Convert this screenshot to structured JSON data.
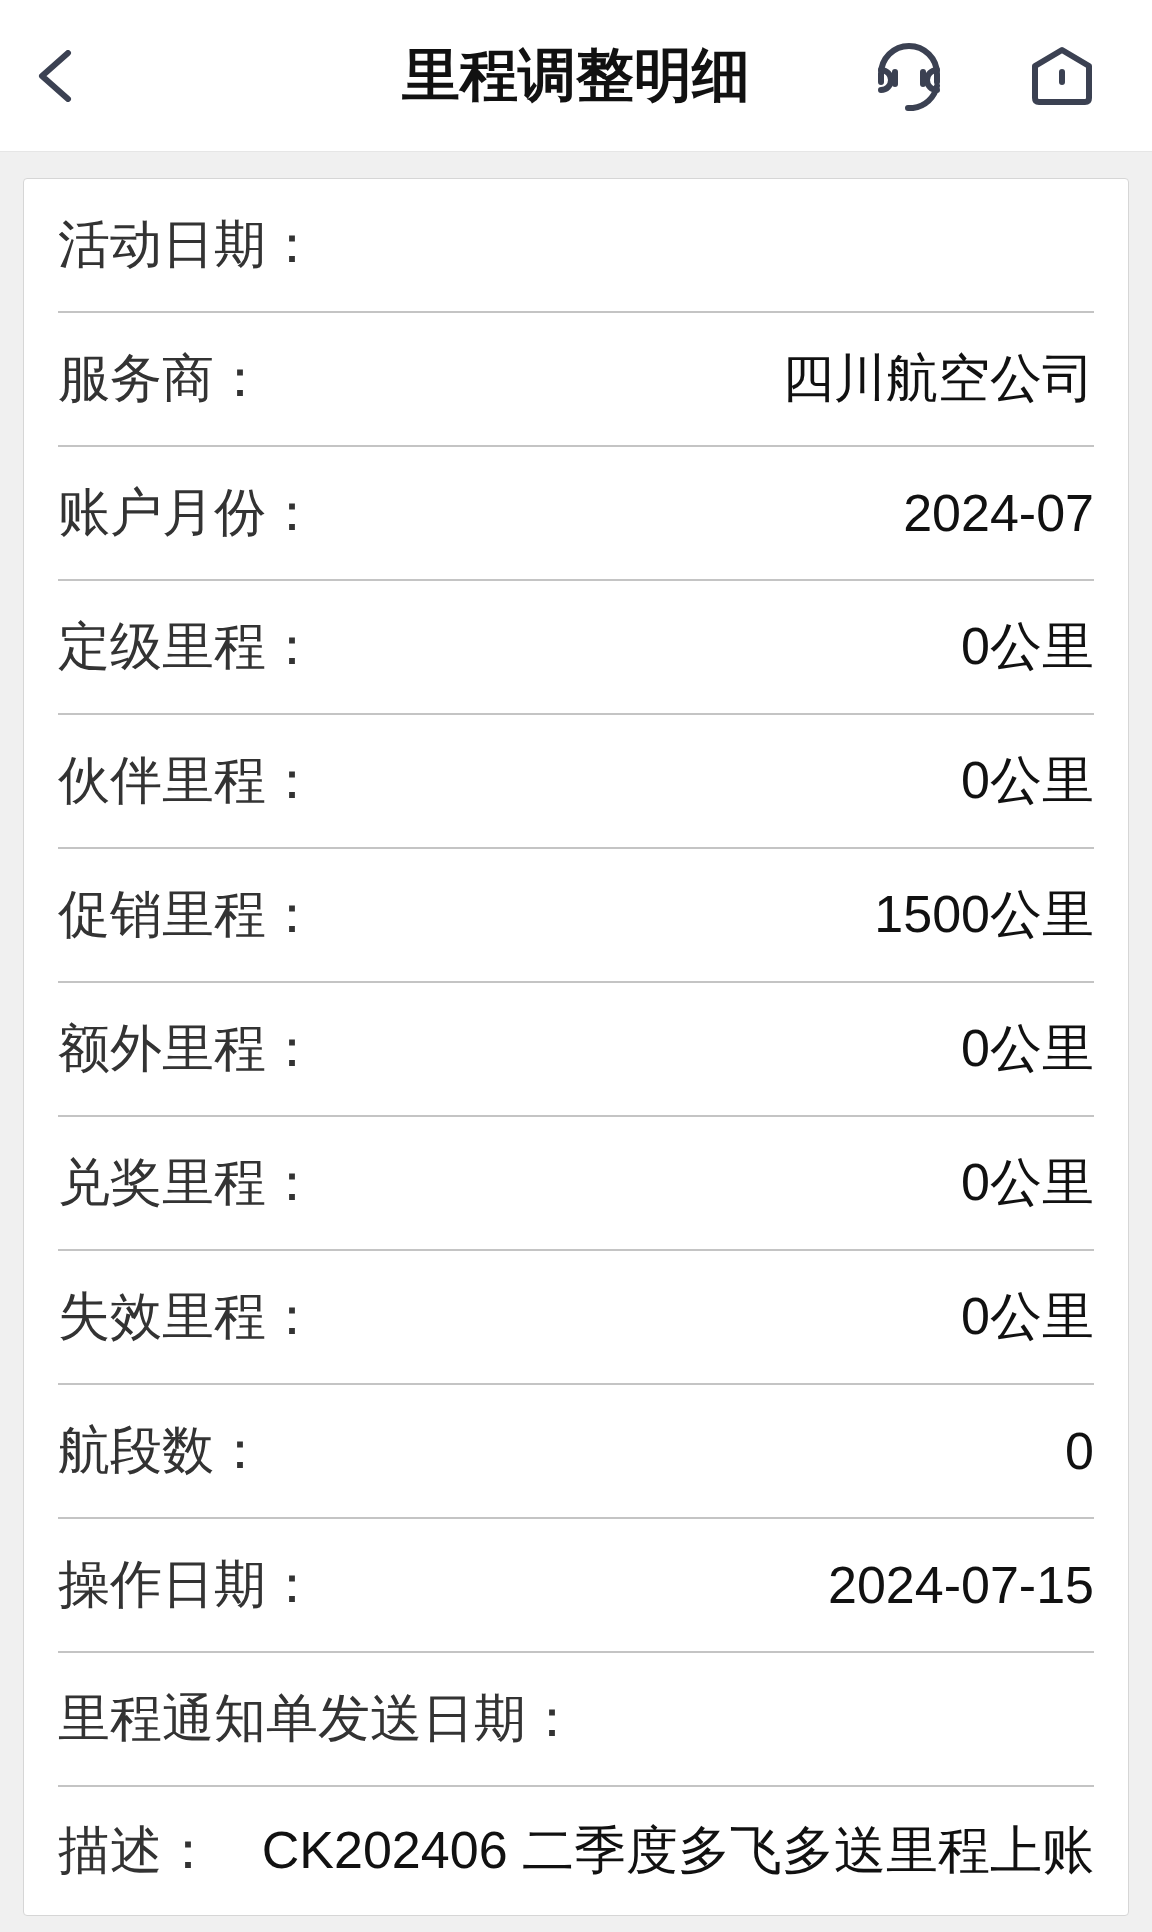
{
  "header": {
    "title": "里程调整明细"
  },
  "details": [
    {
      "label": "活动日期："
    },
    {
      "label": "服务商：",
      "value": "四川航空公司"
    },
    {
      "label": "账户月份：",
      "value": "2024-07"
    },
    {
      "label": "定级里程：",
      "value": "0公里"
    },
    {
      "label": "伙伴里程：",
      "value": "0公里"
    },
    {
      "label": "促销里程：",
      "value": "1500公里"
    },
    {
      "label": "额外里程：",
      "value": "0公里"
    },
    {
      "label": "兑奖里程：",
      "value": "0公里"
    },
    {
      "label": "失效里程：",
      "value": "0公里"
    },
    {
      "label": "航段数：",
      "value": "0"
    },
    {
      "label": "操作日期：",
      "value": "2024-07-15"
    },
    {
      "label": "里程通知单发送日期："
    },
    {
      "label": "描述：",
      "value": "CK202406 二季度多飞多送里程上账"
    }
  ]
}
